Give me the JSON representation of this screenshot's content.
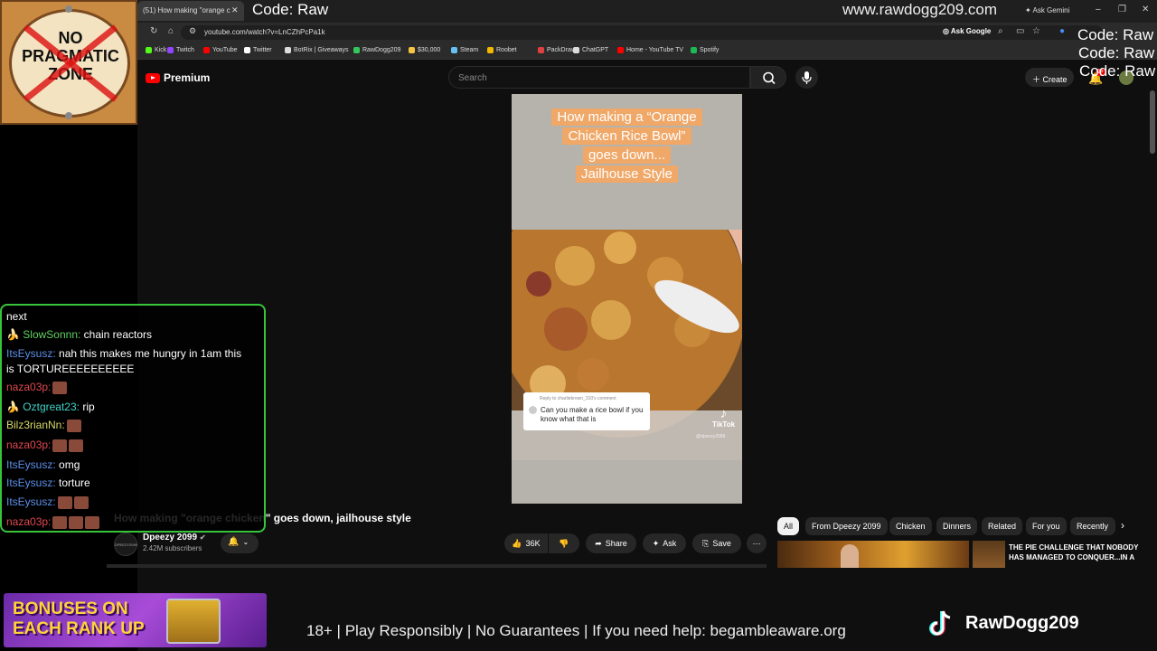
{
  "browser": {
    "tab_title": "(51) How making \"orange c",
    "url": "youtube.com/watch?v=LnCZhPcPa1k",
    "ask_gemini": "Ask Gemini",
    "ask_google": "Ask Google",
    "bookmarks": [
      {
        "label": "Kick",
        "color": "#53fc18"
      },
      {
        "label": "Twitch",
        "color": "#9146ff"
      },
      {
        "label": "YouTube",
        "color": "#ff0000"
      },
      {
        "label": "Twitter",
        "color": "#ffffff"
      },
      {
        "label": "BotRix | Giveaways",
        "color": "#dddddd"
      },
      {
        "label": "RawDogg209",
        "color": "#34c759"
      },
      {
        "label": "$30,000",
        "color": "#f5c542"
      },
      {
        "label": "Steam",
        "color": "#66c0f4"
      },
      {
        "label": "Roobet",
        "color": "#f5b800"
      },
      {
        "label": "PackDraw",
        "color": "#e04040"
      },
      {
        "label": "ChatGPT",
        "color": "#dddddd"
      },
      {
        "label": "Home - YouTube TV",
        "color": "#ff0000"
      },
      {
        "label": "Spotify",
        "color": "#1db954"
      }
    ]
  },
  "overlay": {
    "code_top": "Code: Raw",
    "site": "www.rawdogg209.com",
    "code_right_1": "Code: Raw",
    "code_right_2": "Code: Raw",
    "code_right_3": "Code: Raw",
    "logo_line1": "NO",
    "logo_line2": "PRAGMATIC",
    "logo_line3": "ZONE",
    "bonus_line1": "BONUSES ON",
    "bonus_line2": "EACH RANK UP",
    "disclaimer": "18+ | Play Responsibly | No Guarantees | If you need help: begambleaware.org",
    "streamer": "RawDogg209"
  },
  "youtube": {
    "logo": "Premium",
    "search_placeholder": "Search",
    "create": "Create",
    "notifications": "9+",
    "video": {
      "caption_line1": "How making  a “Orange",
      "caption_line2": "Chicken Rice Bowl”",
      "caption_line3": "goes down...",
      "caption_line4": "Jailhouse Style",
      "reply_header": "Reply to charliebrown_310's comment",
      "reply_text": "Can you make a rice bowl if you know what that is",
      "tiktok": "TikTok",
      "handle": "@dpeezy2099"
    },
    "title": "How making \"orange chicken\" goes down, jailhouse style",
    "channel_name": "Dpeezy 2099",
    "channel_avatar": "DPEEZY2099",
    "subscribers": "2.42M subscribers",
    "likes": "36K",
    "share": "Share",
    "ask": "Ask",
    "save": "Save",
    "chips": [
      "All",
      "From Dpeezy 2099",
      "Chicken",
      "Dinners",
      "Related",
      "For you",
      "Recently"
    ],
    "rec_title": "THE PIE CHALLENGE THAT NOBODY HAS MANAGED TO CONQUER...IN A PACKED OUT PUB!!"
  },
  "chat": {
    "messages": [
      {
        "user": "",
        "text": "next",
        "color": "#ffffff"
      },
      {
        "user": "SlowSonnn:",
        "text": " chain reactors",
        "color": "#5fd35f"
      },
      {
        "user": "ItsEysusz:",
        "text": " nah this makes me hungry in 1am this",
        "color": "#5b8fe8"
      },
      {
        "user": "",
        "text": "is TORTUREEEEEEEEEE",
        "color": "#ffffff"
      },
      {
        "user": "naza03p:",
        "text": "",
        "color": "#e0484f"
      },
      {
        "user": "Oztgreat23:",
        "text": " rip",
        "color": "#3fd3c8"
      },
      {
        "user": "Bilz3rianNn:",
        "text": "",
        "color": "#d8d86a"
      },
      {
        "user": "naza03p:",
        "text": "",
        "color": "#e0484f"
      },
      {
        "user": "ItsEysusz:",
        "text": " omg",
        "color": "#5b8fe8"
      },
      {
        "user": "ItsEysusz:",
        "text": " torture",
        "color": "#5b8fe8"
      },
      {
        "user": "ItsEysusz:",
        "text": "",
        "color": "#5b8fe8"
      },
      {
        "user": "naza03p:",
        "text": "",
        "color": "#e0484f"
      }
    ]
  }
}
